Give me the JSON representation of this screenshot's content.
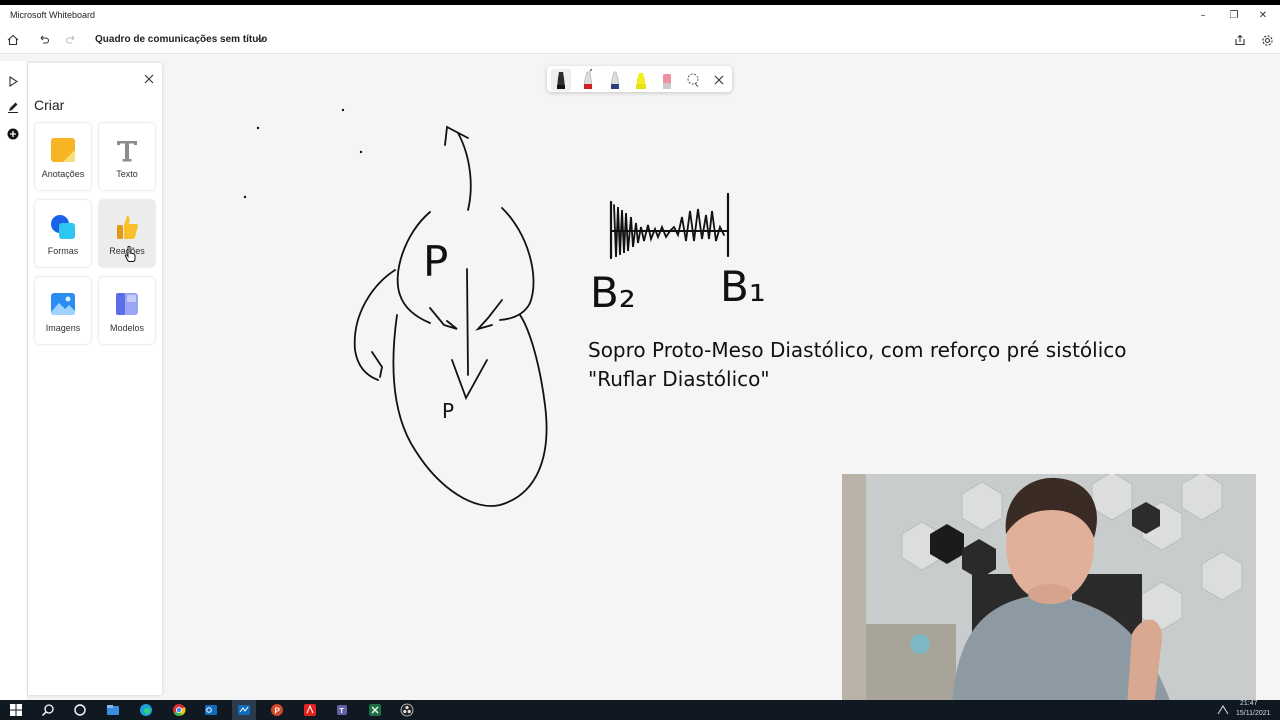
{
  "window": {
    "app_title": "Microsoft Whiteboard",
    "minimize": "–",
    "maximize": "❐",
    "close": "✕"
  },
  "header": {
    "board_title": "Quadro de comunicações sem título",
    "icons": [
      "home-icon",
      "undo-icon",
      "redo-icon",
      "chevron-down-icon",
      "share-icon",
      "settings-icon"
    ]
  },
  "left_rail": {
    "icons": [
      "select-arrow-icon",
      "pen-icon",
      "add-icon"
    ]
  },
  "create_panel": {
    "title": "Criar",
    "items": [
      {
        "label": "Anotações",
        "icon": "sticky-note-icon"
      },
      {
        "label": "Texto",
        "icon": "text-icon"
      },
      {
        "label": "Formas",
        "icon": "shapes-icon"
      },
      {
        "label": "Reações",
        "icon": "thumbs-up-icon"
      },
      {
        "label": "Imagens",
        "icon": "image-icon"
      },
      {
        "label": "Modelos",
        "icon": "templates-icon"
      }
    ]
  },
  "pen_toolbar": {
    "pens": [
      {
        "name": "black-pen",
        "color": "#111111"
      },
      {
        "name": "red-pen",
        "color": "#d0202a"
      },
      {
        "name": "blue-pen",
        "color": "#2a3e80"
      },
      {
        "name": "yellow-highlighter",
        "color": "#f2ee20"
      },
      {
        "name": "pink-eraser",
        "color": "#ef8fa0"
      }
    ],
    "icons": [
      "lasso-icon",
      "close-icon"
    ]
  },
  "canvas": {
    "heart_labels": [
      "P",
      "P"
    ],
    "sound_labels": [
      "B₂",
      "B₁"
    ],
    "note_line_1": "Sopro Proto-Meso Diastólico, com reforço pré sistólico",
    "note_line_2": "\"Ruflar Diastólico\""
  },
  "taskbar": {
    "icons": [
      "windows-start-icon",
      "search-icon",
      "cortana-icon",
      "file-explorer-icon",
      "edge-icon",
      "chrome-icon",
      "outlook-icon",
      "whiteboard-icon",
      "powerpoint-icon",
      "acrobat-icon",
      "teams-icon",
      "excel-icon",
      "obs-icon"
    ],
    "time": "21:47",
    "date": "15/11/2021"
  }
}
